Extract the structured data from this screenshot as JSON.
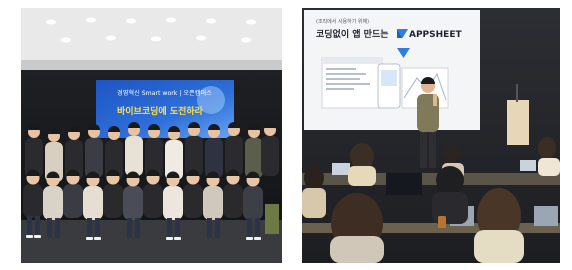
{
  "left_photo": {
    "banner": {
      "line1": "경영혁신 Smart work | 오픈캠퍼스",
      "line2": "바이브코딩에 도전하라"
    }
  },
  "right_photo": {
    "slide": {
      "subtitle": "(조직에서 사용하기 위해)",
      "title_prefix": "코딩없이 앱 만드는",
      "brand": "APPSHEET"
    }
  },
  "colors": {
    "banner_blue": "#2f6fd9",
    "appsheet_blue": "#2f7de1",
    "wall_dark": "#17191d",
    "floor": "#3a3b3f"
  }
}
